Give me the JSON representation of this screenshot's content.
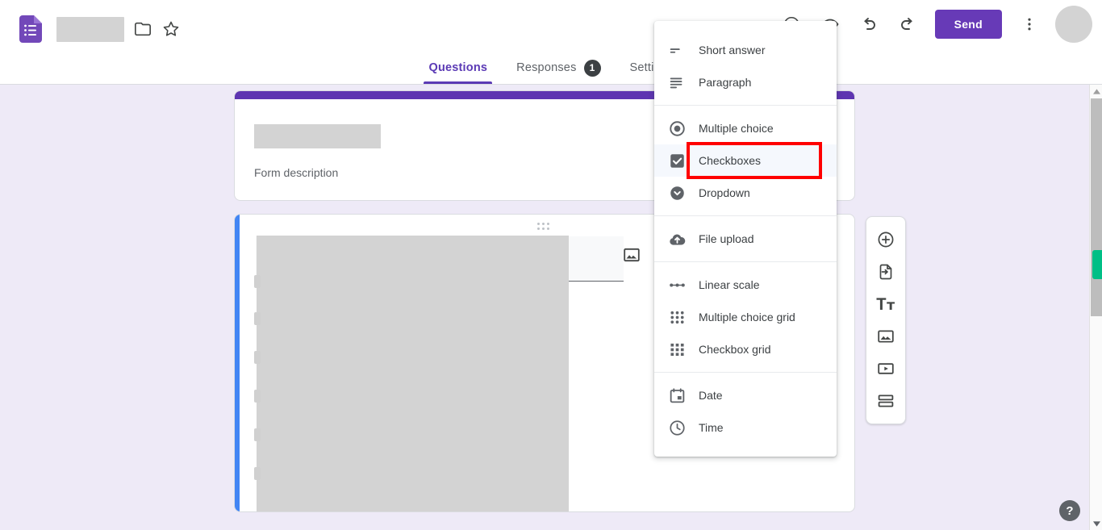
{
  "app": {
    "name": "Google Forms",
    "logo_icon": "forms-logo-icon",
    "title_value": "",
    "folder_icon": "folder-icon",
    "star_icon": "star-outline-icon"
  },
  "tabs": [
    {
      "label": "Questions",
      "active": true,
      "badge": ""
    },
    {
      "label": "Responses",
      "active": false,
      "badge": "1"
    },
    {
      "label": "Settings",
      "active": false,
      "badge": ""
    }
  ],
  "toolbar": {
    "theme_icon": "palette-icon",
    "preview_icon": "eye-preview-icon",
    "undo_icon": "undo-icon",
    "redo_icon": "redo-icon",
    "send_label": "Send",
    "more_icon": "more-vert-icon",
    "avatar_icon": "avatar"
  },
  "form": {
    "header": {
      "title_value": "",
      "description": "Form description"
    },
    "question": {
      "title_value": "",
      "image_icon": "add-image-icon",
      "drag_handle_icon": "drag-handle-icon"
    }
  },
  "float_toolbar": [
    {
      "icon": "add-question-icon",
      "label": "Add question"
    },
    {
      "icon": "import-questions-icon",
      "label": "Import questions"
    },
    {
      "icon": "add-title-icon",
      "label": "Add title and description"
    },
    {
      "icon": "add-image-icon",
      "label": "Add image"
    },
    {
      "icon": "add-video-icon",
      "label": "Add video"
    },
    {
      "icon": "add-section-icon",
      "label": "Add section"
    }
  ],
  "type_menu": {
    "groups": [
      {
        "items": [
          {
            "label": "Short answer",
            "icon": "short-answer-icon",
            "highlighted": false
          },
          {
            "label": "Paragraph",
            "icon": "paragraph-icon",
            "highlighted": false
          }
        ]
      },
      {
        "items": [
          {
            "label": "Multiple choice",
            "icon": "radio-button-icon",
            "highlighted": false
          },
          {
            "label": "Checkboxes",
            "icon": "checkbox-icon",
            "highlighted": true
          },
          {
            "label": "Dropdown",
            "icon": "dropdown-icon",
            "highlighted": false
          }
        ]
      },
      {
        "items": [
          {
            "label": "File upload",
            "icon": "file-upload-icon",
            "highlighted": false
          }
        ]
      },
      {
        "items": [
          {
            "label": "Linear scale",
            "icon": "linear-scale-icon",
            "highlighted": false
          },
          {
            "label": "Multiple choice grid",
            "icon": "radio-grid-icon",
            "highlighted": false
          },
          {
            "label": "Checkbox grid",
            "icon": "checkbox-grid-icon",
            "highlighted": false
          }
        ]
      },
      {
        "items": [
          {
            "label": "Date",
            "icon": "calendar-icon",
            "highlighted": false
          },
          {
            "label": "Time",
            "icon": "clock-icon",
            "highlighted": false
          }
        ]
      }
    ]
  },
  "annotation": {
    "target": "Checkboxes",
    "color": "#ff0000"
  },
  "scrollbar": {
    "up_arrow_icon": "scroll-up-arrow-icon",
    "down_arrow_icon": "scroll-down-arrow-icon",
    "marker_color": "#00bf86"
  },
  "help": {
    "label": "?"
  },
  "colors": {
    "canvas_bg": "#eeeaf7",
    "brand_purple": "#673ab7",
    "header_stripe": "#5e35b1",
    "question_accent": "#4285f4",
    "badge_bg": "#3c4043"
  }
}
